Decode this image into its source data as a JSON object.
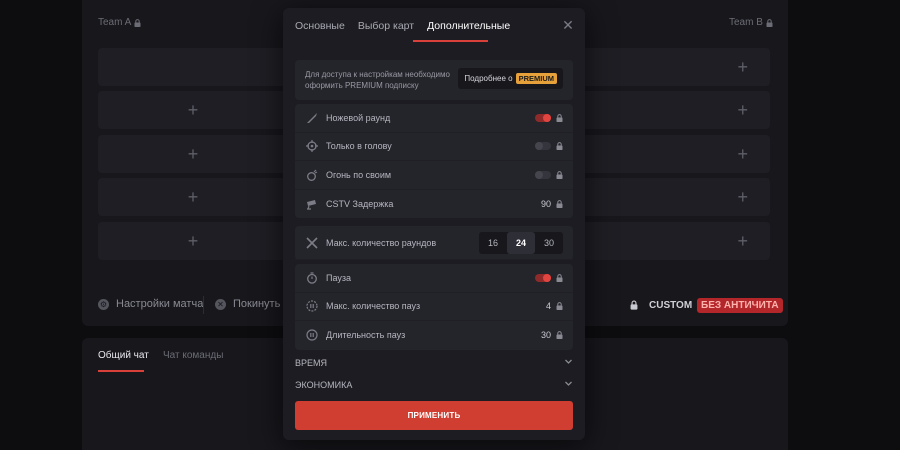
{
  "background": {
    "team_a": "Team A",
    "team_b": "Team B",
    "slot_plus": "+",
    "match_settings": "Настройки матча",
    "leave_match": "Покинуть м",
    "badge_custom": "CUSTOM",
    "badge_no_anticheat": "БЕЗ АНТИЧИТА",
    "chat_tabs": [
      "Общий чат",
      "Чат команды"
    ]
  },
  "modal": {
    "tabs": [
      "Основные",
      "Выбор карт",
      "Дополнительные"
    ],
    "active_tab": "Дополнительные",
    "close_icon": "close-icon",
    "promo": {
      "text": "Для доступа к настройкам необходимо оформить PREMIUM подписку",
      "button_label": "Подробнее о",
      "button_badge": "PREMIUM"
    },
    "options_group1": [
      {
        "label": "Ножевой раунд",
        "icon": "knife-icon",
        "type": "toggle",
        "on": true
      },
      {
        "label": "Только в голову",
        "icon": "crosshair-icon",
        "type": "toggle",
        "on": false
      },
      {
        "label": "Огонь по своим",
        "icon": "grenade-icon",
        "type": "toggle",
        "on": false
      },
      {
        "label": "CSTV Задержка",
        "icon": "camera-icon",
        "type": "value",
        "value": "90"
      }
    ],
    "rounds": {
      "label": "Макс. количество раундов",
      "icon": "swords-icon",
      "options": [
        "16",
        "24",
        "30"
      ],
      "selected": "24"
    },
    "options_group2": [
      {
        "label": "Пауза",
        "icon": "timer-icon",
        "type": "toggle",
        "on": true
      },
      {
        "label": "Макс. количество пауз",
        "icon": "pause-count-icon",
        "type": "value",
        "value": "4"
      },
      {
        "label": "Длительность пауз",
        "icon": "pause-duration-icon",
        "type": "value",
        "value": "30"
      }
    ],
    "sections": [
      "ВРЕМЯ",
      "ЭКОНОМИКА"
    ],
    "apply_label": "ПРИМЕНИТЬ"
  },
  "colors": {
    "accent": "#d03d31",
    "premium": "#e6a13a"
  }
}
